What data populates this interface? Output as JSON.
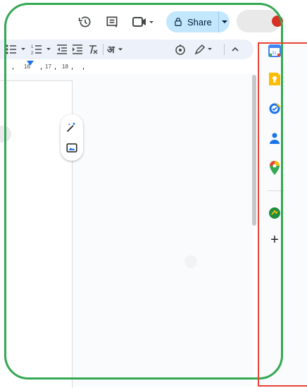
{
  "header": {
    "share_label": "Share"
  },
  "ruler": {
    "ticks": [
      "16",
      "17",
      "18"
    ]
  },
  "toolbar": {
    "hindi_input_label": "अ"
  },
  "icons": {
    "history": "history-icon",
    "comments": "comments-icon",
    "meet": "video-camera-icon",
    "lock": "lock-icon",
    "bulleted_list": "bulleted-list-icon",
    "numbered_list": "numbered-list-icon",
    "decrease_indent": "decrease-indent-icon",
    "increase_indent": "increase-indent-icon",
    "clear_formatting": "clear-formatting-icon",
    "voice": "voice-typing-icon",
    "edit_mode": "pencil-icon",
    "collapse": "chevron-up-icon"
  },
  "side_panel": {
    "apps": [
      {
        "name": "Calendar",
        "icon": "calendar-icon",
        "color": "#4285f4"
      },
      {
        "name": "Keep",
        "icon": "keep-icon",
        "color": "#fbbc04"
      },
      {
        "name": "Tasks",
        "icon": "tasks-icon",
        "color": "#1a73e8"
      },
      {
        "name": "Contacts",
        "icon": "contacts-icon",
        "color": "#1a73e8"
      },
      {
        "name": "Maps",
        "icon": "maps-icon",
        "color": "#34a853"
      },
      {
        "name": "Add-on",
        "icon": "addon-icon",
        "color": "#1e8e3e"
      }
    ],
    "add_label": "+"
  },
  "colors": {
    "annotation_green": "#34a853",
    "annotation_red": "#ea4335",
    "share_bg": "#c2e7ff",
    "toolbar_bg": "#edf2fa"
  }
}
